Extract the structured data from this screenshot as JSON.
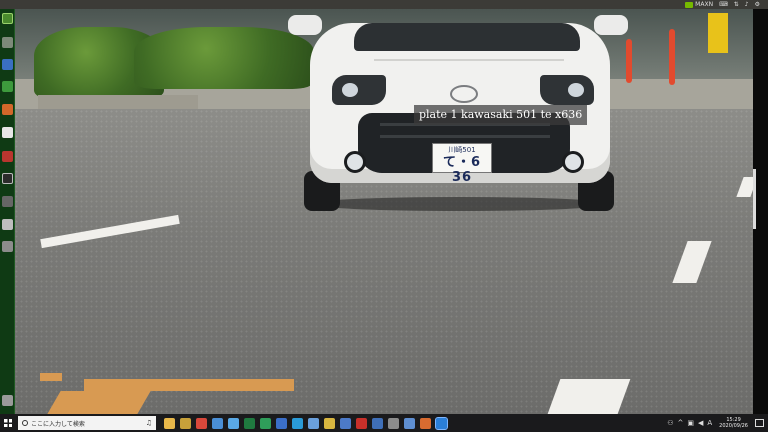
{
  "top_panel": {
    "indicator_text": "MAXN"
  },
  "detection": {
    "label": "plate 1 kawasaki 501 te x636"
  },
  "plate": {
    "top_line": "川崎501",
    "bottom_line": "て・6 36"
  },
  "launcher": {
    "items": [
      {
        "icon": "ubuntu-home-icon"
      },
      {
        "icon": "files-icon"
      },
      {
        "icon": "writer-icon"
      },
      {
        "icon": "calc-icon"
      },
      {
        "icon": "impress-icon"
      },
      {
        "icon": "software-center-icon"
      },
      {
        "icon": "settings-icon"
      },
      {
        "icon": "terminal-icon"
      },
      {
        "icon": "help-icon"
      },
      {
        "icon": "disk-icon"
      },
      {
        "icon": "usb-icon"
      },
      {
        "icon": "trash-icon"
      }
    ]
  },
  "taskbar": {
    "search_placeholder": "ここに入力して検索",
    "apps": [
      {
        "icon": "file-explorer-icon",
        "color": "#e8b84a"
      },
      {
        "icon": "app-icon-2",
        "color": "#c7a13a"
      },
      {
        "icon": "chrome-icon",
        "color": "#d9483b"
      },
      {
        "icon": "app-icon-4",
        "color": "#4a8fd6"
      },
      {
        "icon": "app-icon-5",
        "color": "#5aa9e6"
      },
      {
        "icon": "excel-icon",
        "color": "#1f7a3f"
      },
      {
        "icon": "app-icon-7",
        "color": "#2f9e5a"
      },
      {
        "icon": "app-icon-8",
        "color": "#3b6fc9"
      },
      {
        "icon": "app-icon-9",
        "color": "#2a9bd8"
      },
      {
        "icon": "app-icon-10",
        "color": "#6aa0dc"
      },
      {
        "icon": "app-icon-11",
        "color": "#d8b640"
      },
      {
        "icon": "app-icon-12",
        "color": "#4c7ac8"
      },
      {
        "icon": "acrobat-icon",
        "color": "#c8302a"
      },
      {
        "icon": "app-icon-14",
        "color": "#3f6fb8"
      },
      {
        "icon": "app-icon-15",
        "color": "#8c8c8c"
      },
      {
        "icon": "app-icon-16",
        "color": "#5f8fd2"
      },
      {
        "icon": "app-icon-17",
        "color": "#d86b30"
      },
      {
        "icon": "media-player-icon",
        "color": "#2b7fd8",
        "active": true
      }
    ],
    "clock_time": "15:29",
    "clock_date": "2020/09/26"
  }
}
